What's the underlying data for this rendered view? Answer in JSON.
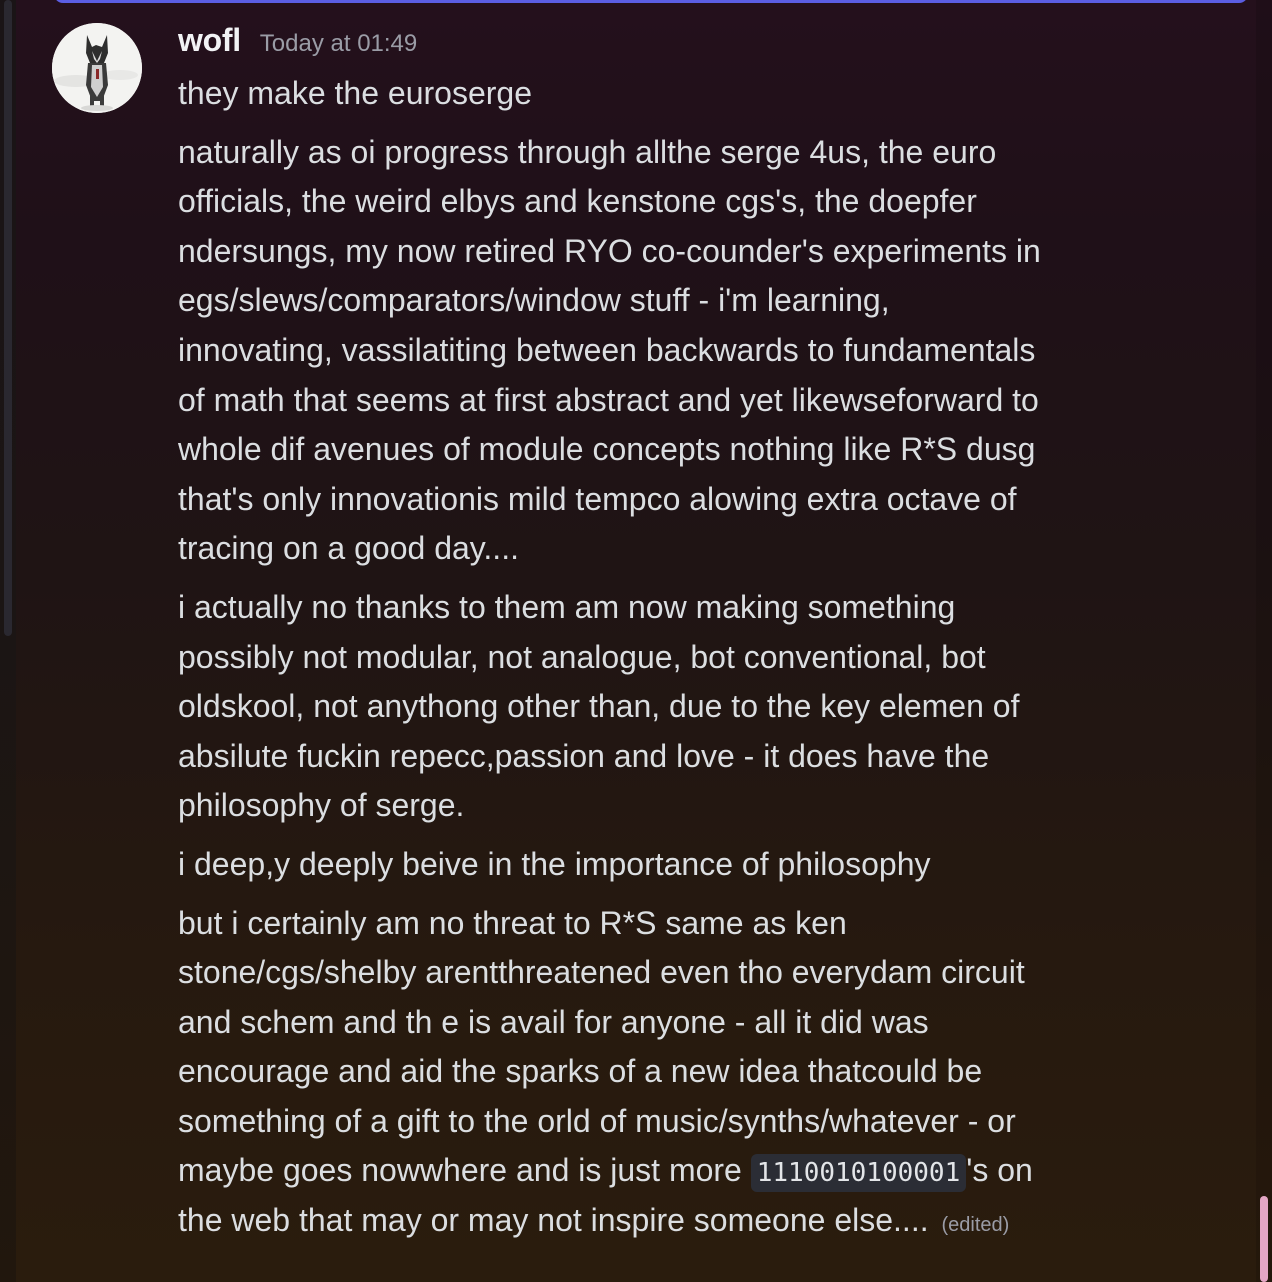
{
  "message": {
    "author": "wofl",
    "timestamp": "Today at 01:49",
    "avatar_icon": "husky-dog-avatar",
    "paragraphs": [
      {
        "lines": [
          "they make the euroserge"
        ]
      },
      {
        "lines": [
          "naturally as oi progress through allthe serge 4us, the euro",
          "officials, the weird elbys and kenstone cgs's, the doepfer",
          "ndersungs, my now retired RYO co-counder's experiments in",
          "egs/slews/comparators/window stuff - i'm learning,",
          "innovating, vassilatiting between backwards to fundamentals",
          "of math that seems at first abstract and yet likewseforward to",
          "whole dif avenues of module concepts nothing like R*S dusg",
          "that's only innovationis mild tempco alowing extra octave of",
          "tracing on a good day...."
        ]
      },
      {
        "lines": [
          "i actually no thanks to them am now making something",
          "possibly not modular, not analogue, bot conventional, bot",
          "oldskool, not anythong other than, due to the key elemen of",
          "absilute fuckin repecc,passion and love - it does have the",
          "philosophy of serge."
        ]
      },
      {
        "lines": [
          "i deep,y deeply beive in the importance of philosophy"
        ]
      },
      {
        "lines": [
          "but i certainly am no threat to R*S same as ken",
          "stone/cgs/shelby arentthreatened even tho everydam circuit",
          "and schem and th e is avail for anyone - all it did was",
          "encourage and aid the sparks of a new idea thatcould be",
          "something of a gift to the orld of  music/synths/whatever - or"
        ]
      }
    ],
    "last_line": {
      "before_code": "maybe goes nowwhere and is just more ",
      "code": "1110010100001",
      "after_code": "'s on"
    },
    "final_line": "the web that may or may not inspire someone else....",
    "edited_label": "(edited)"
  },
  "colors": {
    "accent_bar": "#5b5ee3",
    "scroll_thumb": "#e4a6c4",
    "text": "#dbdee1",
    "muted": "#9a9ca6"
  }
}
